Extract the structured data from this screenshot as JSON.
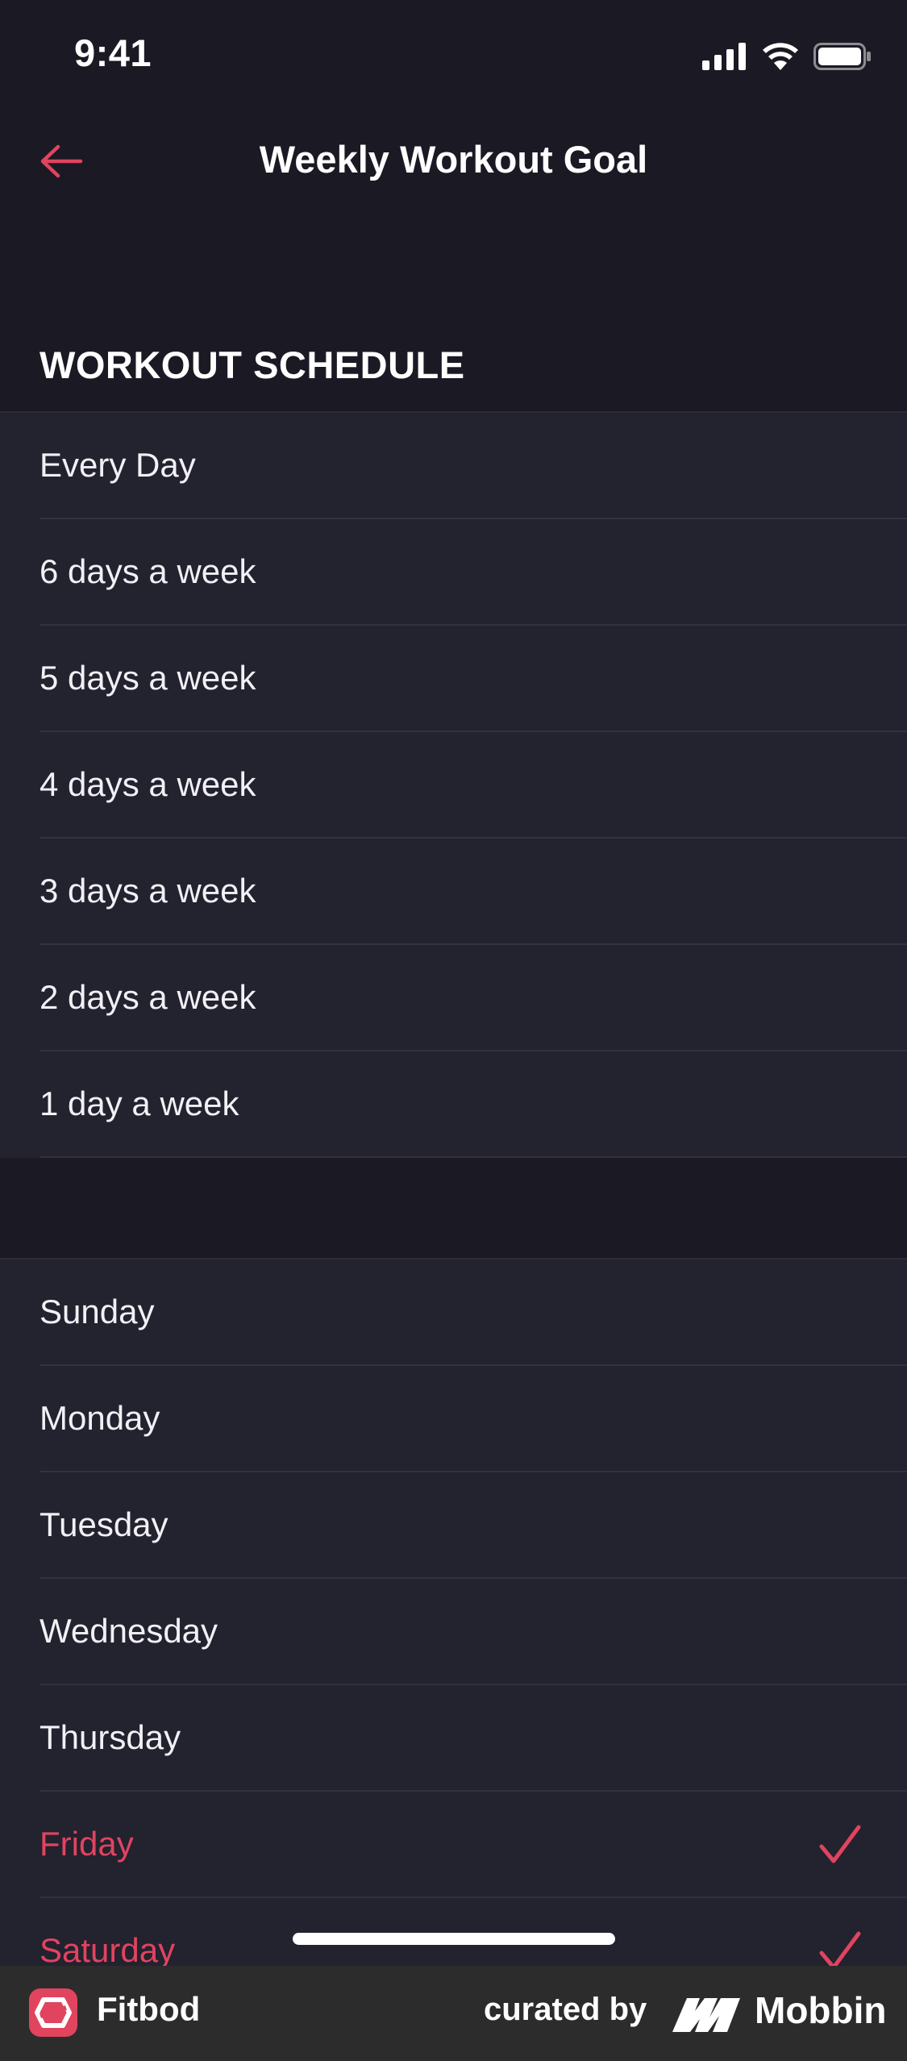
{
  "status_bar": {
    "time": "9:41"
  },
  "nav": {
    "title": "Weekly Workout Goal",
    "back_icon": "arrow-left-icon"
  },
  "schedule": {
    "header": "WORKOUT SCHEDULE",
    "options": [
      {
        "label": "Every Day"
      },
      {
        "label": "6 days a week"
      },
      {
        "label": "5 days a week"
      },
      {
        "label": "4 days a week"
      },
      {
        "label": "3 days a week"
      },
      {
        "label": "2 days a week"
      },
      {
        "label": "1 day a week"
      }
    ]
  },
  "days": {
    "items": [
      {
        "label": "Sunday",
        "selected": false
      },
      {
        "label": "Monday",
        "selected": false
      },
      {
        "label": "Tuesday",
        "selected": false
      },
      {
        "label": "Wednesday",
        "selected": false
      },
      {
        "label": "Thursday",
        "selected": false
      },
      {
        "label": "Friday",
        "selected": true
      },
      {
        "label": "Saturday",
        "selected": true
      }
    ]
  },
  "footer": {
    "brand": "Fitbod",
    "curated_by": "curated by",
    "mobbin": "Mobbin"
  },
  "colors": {
    "accent": "#e0445f",
    "background": "#1b1a24",
    "row_background": "#23222f"
  }
}
